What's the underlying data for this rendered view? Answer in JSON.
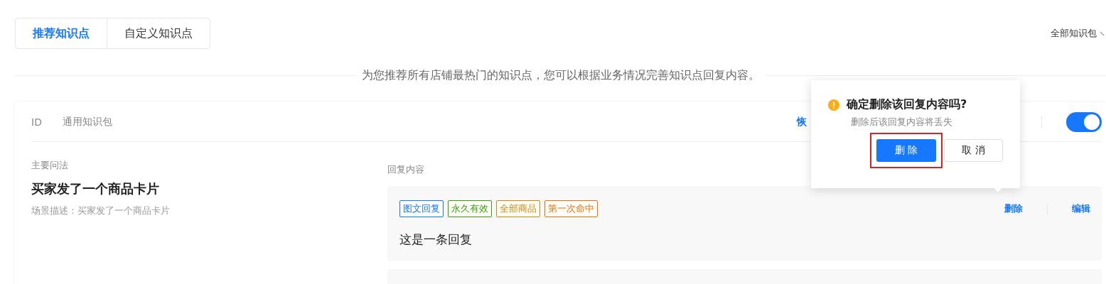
{
  "tabs": [
    {
      "label": "推荐知识点",
      "selected": true
    },
    {
      "label": "自定义知识点",
      "selected": false
    }
  ],
  "package_filter": {
    "value": "全部知识包"
  },
  "notice": "为您推荐所有店铺最热门的知识点，您可以根据业务情况完善知识点回复内容。",
  "card": {
    "id_label": "ID",
    "package": "通用知识包",
    "restore_link": "恢",
    "enabled": true,
    "question_label": "主要问法",
    "question": "买家发了一个商品卡片",
    "scene": "场景描述：买家发了一个商品卡片",
    "reply_label": "回复内容",
    "replies": [
      {
        "tags": [
          {
            "text": "图文回复",
            "color": "#1677ff"
          },
          {
            "text": "永久有效",
            "color": "#389e0d"
          },
          {
            "text": "全部商品",
            "color": "#d48806"
          },
          {
            "text": "第一次命中",
            "color": "#e8720c"
          }
        ],
        "text": "这是一条回复",
        "actions": [
          "删除",
          "编辑"
        ]
      }
    ]
  },
  "popconfirm": {
    "title": "确定删除该回复内容吗?",
    "description": "删除后该回复内容将丢失",
    "ok": "删 除",
    "cancel": "取 消",
    "ok_highlighted": true
  }
}
